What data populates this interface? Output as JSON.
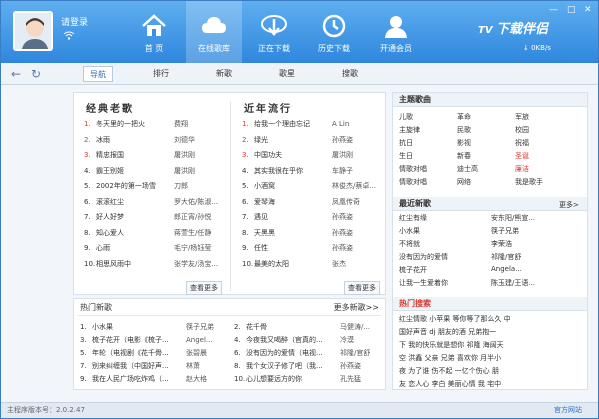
{
  "user": {
    "login": "请登录",
    "status": "◆"
  },
  "nav": [
    {
      "label": "首 页"
    },
    {
      "label": "在线歌库"
    },
    {
      "label": "正在下载"
    },
    {
      "label": "历史下载"
    },
    {
      "label": "开通会员"
    }
  ],
  "brand": "下载伴侣",
  "speed": "0KB/s",
  "subtabs": [
    "导航",
    "排行",
    "新歌",
    "歌星",
    "搜歌"
  ],
  "classic": {
    "title": "经典老歌",
    "more": "查看更多",
    "items": [
      {
        "n": "1.",
        "title": "冬天里的一把火",
        "artist": "费翔"
      },
      {
        "n": "2.",
        "title": "冰雨",
        "artist": "刘德华"
      },
      {
        "n": "3.",
        "title": "精忠报国",
        "artist": "屠洪刚"
      },
      {
        "n": "4.",
        "title": "霸王别姬",
        "artist": "屠洪刚"
      },
      {
        "n": "5.",
        "title": "2002年的第一场雪",
        "artist": "刀郎"
      },
      {
        "n": "6.",
        "title": "滚滚红尘",
        "artist": "罗大佑/陈淑..."
      },
      {
        "n": "7.",
        "title": "好人好梦",
        "artist": "郎正宵/孙悦"
      },
      {
        "n": "8.",
        "title": "知心爱人",
        "artist": "蒋萱生/任静"
      },
      {
        "n": "9.",
        "title": "心雨",
        "artist": "毛宁/杨钰莹"
      },
      {
        "n": "10.",
        "title": "相思风雨中",
        "artist": "张学友/汤宝..."
      }
    ]
  },
  "popular": {
    "title": "近年流行",
    "more": "查看更多",
    "items": [
      {
        "n": "1.",
        "title": "给我一个理由忘记",
        "artist": "A Lin"
      },
      {
        "n": "2.",
        "title": "绿光",
        "artist": "孙燕姿"
      },
      {
        "n": "3.",
        "title": "中国功夫",
        "artist": "屠洪刚"
      },
      {
        "n": "4.",
        "title": "其实我很在乎你",
        "artist": "车静子"
      },
      {
        "n": "5.",
        "title": "小酒窝",
        "artist": "林俊杰/蔡卓..."
      },
      {
        "n": "6.",
        "title": "爱琴海",
        "artist": "凤凰传奇"
      },
      {
        "n": "7.",
        "title": "遇见",
        "artist": "孙燕姿"
      },
      {
        "n": "8.",
        "title": "天黑黑",
        "artist": "孙燕姿"
      },
      {
        "n": "9.",
        "title": "任性",
        "artist": "孙燕姿"
      },
      {
        "n": "10.",
        "title": "最美的太阳",
        "artist": "张杰"
      }
    ]
  },
  "hotnew": {
    "title": "热门新歌",
    "more": "更多新歌>>",
    "left": [
      {
        "n": "1.",
        "title": "小水果",
        "artist": "筷子兄弟"
      },
      {
        "n": "3.",
        "title": "梳子花开（电影《梳子...",
        "artist": "Angel..."
      },
      {
        "n": "5.",
        "title": "年轮（电视剧《花千骨...",
        "artist": "张碧晨"
      },
      {
        "n": "7.",
        "title": "别来纠缠我（中国好声...",
        "artist": "林萧"
      },
      {
        "n": "9.",
        "title": "我在人民广场吃炸鸡（...",
        "artist": "赵大格"
      }
    ],
    "right": [
      {
        "n": "2.",
        "title": "花千骨",
        "artist": "马健涛/..."
      },
      {
        "n": "4.",
        "title": "今夜我又喝醉（官真的...",
        "artist": "冷漠"
      },
      {
        "n": "6.",
        "title": "没有因为的爱情（电视...",
        "artist": "祁隆/官舒"
      },
      {
        "n": "8.",
        "title": "我个女汉子修了吧（我...",
        "artist": "孙燕姿"
      },
      {
        "n": "10.",
        "title": "心儿想要远方的你",
        "artist": "孔先猛"
      }
    ]
  },
  "theme": {
    "title": "主题歌曲",
    "rows": [
      [
        "儿歌",
        "革命",
        "军旅"
      ],
      [
        "主旋律",
        "民歌",
        "校园"
      ],
      [
        "抗日",
        "影视",
        "祝福"
      ],
      [
        "生日",
        "新春",
        "圣诞"
      ],
      [
        "情歌对唱",
        "迪士高",
        "廉洁"
      ],
      [
        "情歌对唱",
        "网络",
        "我是歌手"
      ]
    ]
  },
  "latest": {
    "title": "最近新歌",
    "more": "更多>",
    "rows": [
      [
        "红尘有缘",
        "安东阳/熊宣..."
      ],
      [
        "小水果",
        "筷子兄弟"
      ],
      [
        "不将就",
        "李荣浩"
      ],
      [
        "没有因为的爱情",
        "祁隆/官舒"
      ],
      [
        "梳子花开",
        "Angela..."
      ],
      [
        "让我一生爱着你",
        "陈玉建/王语..."
      ]
    ]
  },
  "hotsearch": {
    "title": "热门搜索",
    "lines": [
      "红尘情歌 小苹果 等你等了那么久 中",
      "国好声音 dj 朋友的酒 兄弟抱一",
      "下 我的快乐就是想你 祁隆 海阔天",
      "空 洪鑫 父亲 兄弟 喜欢你 月半小",
      "夜 为了谁 伤不起 一亿个伤心 朋",
      "友 恋人心 李白 美丽心情 我 宅中"
    ]
  },
  "footer": {
    "version": "主程序版本号：2.0.2.47",
    "site": "官方网站"
  },
  "colors": {
    "topbar": "#3c95e6",
    "accent": "#2a70c5",
    "red": "#d93a2f"
  }
}
